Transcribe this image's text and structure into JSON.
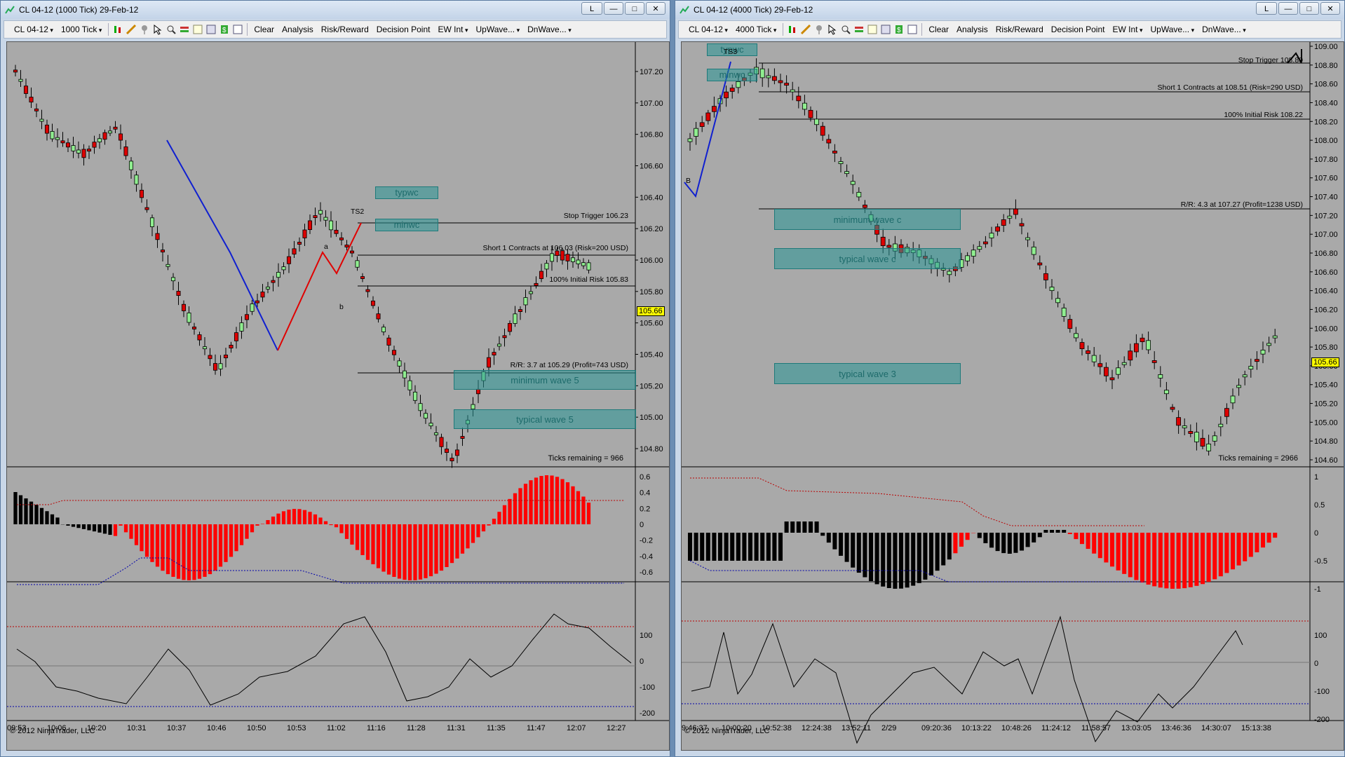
{
  "left_window": {
    "title": "CL 04-12 (1000 Tick)  29-Feb-12",
    "toolbar": {
      "instrument": "CL 04-12",
      "period": "1000 Tick",
      "clear": "Clear",
      "analysis": "Analysis",
      "risk_reward": "Risk/Reward",
      "decision_point": "Decision Point",
      "ew_int": "EW Int",
      "upwave": "UpWave...",
      "dnwave": "DnWave..."
    },
    "price_axis": [
      "107.20",
      "107.00",
      "106.80",
      "106.60",
      "106.40",
      "106.20",
      "106.00",
      "105.80",
      "105.60",
      "105.40",
      "105.20",
      "105.00",
      "104.80"
    ],
    "current_price": "105.66",
    "levels": {
      "stop_trigger": "Stop Trigger 106.23",
      "short_entry": "Short 1 Contracts at 106.03 (Risk=200 USD)",
      "initial_risk": "100% Initial Risk 105.83",
      "rr": "R/R: 3.7 at 105.29 (Profit=743 USD)"
    },
    "zones": {
      "typwc": "typwc",
      "minwc": "minwc",
      "min_wave5": "minimum wave 5",
      "typ_wave5": "typical wave 5"
    },
    "wave_labels": {
      "ts2": "TS2",
      "a": "a",
      "b": "b"
    },
    "ticks_remaining": "Ticks remaining = 966",
    "osc1_axis": [
      "0.6",
      "0.4",
      "0.2",
      "0",
      "-0.2",
      "-0.4",
      "-0.6"
    ],
    "osc2_axis": [
      "100",
      "0",
      "-100",
      "-200"
    ],
    "x_axis": [
      "09:53",
      "10:06",
      "10:20",
      "10:31",
      "10:37",
      "10:46",
      "10:50",
      "10:53",
      "11:02",
      "11:16",
      "11:28",
      "11:31",
      "11:35",
      "11:47",
      "12:07",
      "12:27"
    ],
    "copyright": "© 2012 NinjaTrader, LLC"
  },
  "right_window": {
    "title": "CL 04-12 (4000 Tick)  29-Feb-12",
    "toolbar": {
      "instrument": "CL 04-12",
      "period": "4000 Tick",
      "clear": "Clear",
      "analysis": "Analysis",
      "risk_reward": "Risk/Reward",
      "decision_point": "Decision Point",
      "ew_int": "EW Int",
      "upwave": "UpWave...",
      "dnwave": "DnWave..."
    },
    "price_axis": [
      "109.00",
      "108.80",
      "108.60",
      "108.40",
      "108.20",
      "108.00",
      "107.80",
      "107.60",
      "107.40",
      "107.20",
      "107.00",
      "106.80",
      "106.60",
      "106.40",
      "106.20",
      "106.00",
      "105.80",
      "105.60",
      "105.40",
      "105.20",
      "105.00",
      "104.80",
      "104.60"
    ],
    "current_price": "105.66",
    "levels": {
      "stop_trigger": "Stop Trigger 108.80",
      "short_entry": "Short 1 Contracts at 108.51 (Risk=290 USD)",
      "initial_risk": "100% Initial Risk 108.22",
      "rr": "R/R: 4.3 at 107.27 (Profit=1238 USD)"
    },
    "zones": {
      "typwc": "typwc",
      "minwc": "minwc",
      "min_wave_c": "minimum wave c",
      "typ_wave_c": "typical wave c",
      "typ_wave3": "typical wave 3"
    },
    "wave_labels": {
      "ts3": "TS3",
      "b": "B"
    },
    "ticks_remaining": "Ticks remaining = 2966",
    "osc1_axis": [
      "1",
      "0.5",
      "0",
      "-0.5",
      "-1"
    ],
    "osc2_axis": [
      "100",
      "0",
      "-100",
      "-200"
    ],
    "x_axis": [
      "9:46:37",
      "10:00:20",
      "10:52:38",
      "12:24:38",
      "13:52:11",
      "2/29",
      "09:20:36",
      "10:13:22",
      "10:48:26",
      "11:24:12",
      "11:58:57",
      "13:03:05",
      "13:46:36",
      "14:30:07",
      "15:13:38"
    ],
    "copyright": "© 2012 NinjaTrader, LLC"
  },
  "colors": {
    "chart_bg": "#a9a9a9",
    "up_candle": "#90ee90",
    "down_candle": "#dd0000",
    "zone": "#2a9a9a",
    "hist_red": "#ff0000",
    "hist_black": "#000000"
  }
}
